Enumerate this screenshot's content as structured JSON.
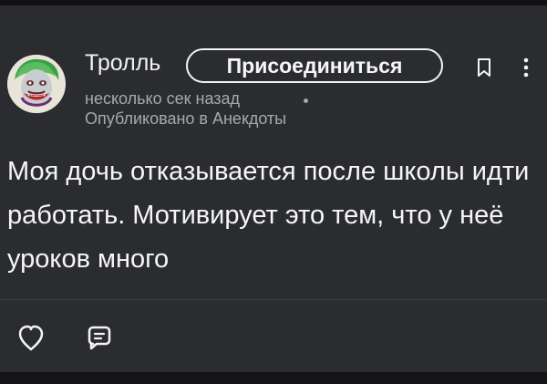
{
  "post": {
    "author": "Тролль",
    "join_label": "Присоединиться",
    "time": "несколько сек назад",
    "community": "Опубликовано в Анекдоты",
    "body": "Моя дочь отказывается после школы идти работать. Мотивирует это тем, что у неё уроков много"
  },
  "icons": {
    "avatar": "joker-avatar-icon",
    "bookmark": "bookmark-icon",
    "menu": "more-vertical-icon",
    "like": "heart-icon",
    "comment": "comment-icon"
  },
  "colors": {
    "background": "#2a2c30",
    "text": "#f6f6f6",
    "meta": "#a7a9ad"
  }
}
